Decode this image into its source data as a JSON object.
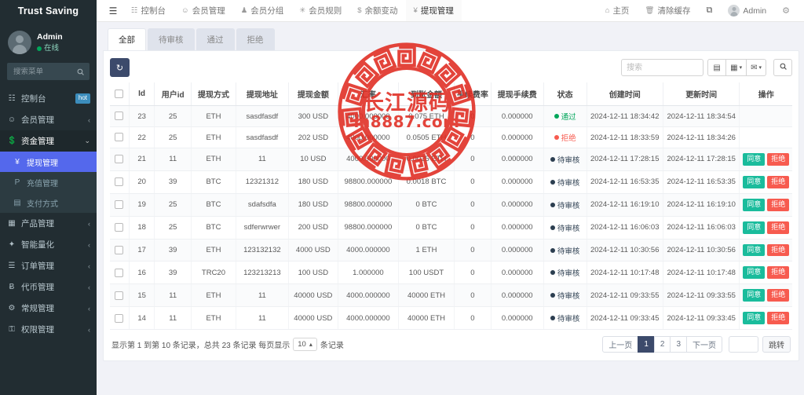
{
  "brand": {
    "title": "Trust Saving"
  },
  "user": {
    "name": "Admin",
    "status": "在线",
    "avatar_icon": "user-avatar-icon"
  },
  "sidebar": {
    "search_placeholder": "搜索菜单",
    "search_icon": "search-icon",
    "items": [
      {
        "label": "控制台",
        "icon": "dashboard-icon",
        "badge": "hot",
        "caret": ""
      },
      {
        "label": "会员管理",
        "icon": "user-icon",
        "badge": "",
        "caret": "‹"
      },
      {
        "label": "资金管理",
        "icon": "money-icon",
        "badge": "",
        "caret": "⌄"
      },
      {
        "label": "产品管理",
        "icon": "cubes-icon",
        "badge": "",
        "caret": "‹"
      },
      {
        "label": "智能量化",
        "icon": "diamond-icon",
        "badge": "",
        "caret": "‹"
      },
      {
        "label": "订单管理",
        "icon": "list-icon",
        "badge": "",
        "caret": "‹"
      },
      {
        "label": "代币管理",
        "icon": "bitcoin-icon",
        "badge": "",
        "caret": "‹"
      },
      {
        "label": "常规管理",
        "icon": "cogs-icon",
        "badge": "",
        "caret": "‹"
      },
      {
        "label": "权限管理",
        "icon": "shield-icon",
        "badge": "",
        "caret": "‹"
      }
    ],
    "submenu": [
      {
        "label": "提现管理",
        "icon": "yen-icon",
        "active": true
      },
      {
        "label": "充值管理",
        "icon": "paypal-icon",
        "active": false
      },
      {
        "label": "支付方式",
        "icon": "credit-card-icon",
        "active": false
      }
    ]
  },
  "navbar": {
    "burger_icon": "hamburger-icon",
    "left_items": [
      {
        "label": "控制台",
        "icon": "dashboard-icon",
        "selected": false
      },
      {
        "label": "会员管理",
        "icon": "user-icon",
        "selected": false
      },
      {
        "label": "会员分组",
        "icon": "group-icon",
        "selected": false
      },
      {
        "label": "会员规则",
        "icon": "wrench-icon",
        "selected": false
      },
      {
        "label": "余额变动",
        "icon": "dollar-icon",
        "selected": false
      },
      {
        "label": "提现管理",
        "icon": "yen-icon",
        "selected": true
      }
    ],
    "right_items": [
      {
        "label": "主页",
        "icon": "home-icon"
      },
      {
        "label": "清除缓存",
        "icon": "trash-icon"
      },
      {
        "label": "",
        "icon": "fullscreen-icon"
      },
      {
        "label": "Admin",
        "icon": "avatar-icon"
      },
      {
        "label": "",
        "icon": "gear-icon"
      }
    ]
  },
  "tabs": [
    {
      "label": "全部",
      "active": true
    },
    {
      "label": "待审核",
      "active": false
    },
    {
      "label": "通过",
      "active": false
    },
    {
      "label": "拒绝",
      "active": false
    }
  ],
  "toolbar": {
    "refresh_icon": "refresh-icon",
    "search_placeholder": "搜索",
    "search_value": "",
    "buttons": [
      {
        "icon": "columns-icon",
        "caret": ""
      },
      {
        "icon": "table-grid-icon",
        "caret": "▾"
      },
      {
        "icon": "export-icon",
        "caret": "▾"
      },
      {
        "icon": "search-icon",
        "caret": ""
      }
    ]
  },
  "table": {
    "select_all_icon": "checkbox-icon",
    "columns": [
      "Id",
      "用户id",
      "提现方式",
      "提现地址",
      "提现金额",
      "汇率",
      "到账金额",
      "手续费率",
      "提现手续费",
      "状态",
      "创建时间",
      "更新时间",
      "操作"
    ],
    "action_labels": {
      "approve": "同意",
      "reject": "拒绝"
    },
    "rows": [
      {
        "id": "23",
        "user_id": "25",
        "method": "ETH",
        "address": "sasdfasdf",
        "amount": "300 USD",
        "rate": "4000.000000",
        "received": "0.075 ETH",
        "fee_rate": "0",
        "fee": "0.000000",
        "status": "通过",
        "status_color": "#00a65a",
        "created": "2024-12-11 18:34:42",
        "updated": "2024-12-11 18:34:54",
        "has_actions": false
      },
      {
        "id": "22",
        "user_id": "25",
        "method": "ETH",
        "address": "sasdfasdf",
        "amount": "202 USD",
        "rate": "4000.000000",
        "received": "0.0505 ETH",
        "fee_rate": "0",
        "fee": "0.000000",
        "status": "拒绝",
        "status_color": "#f75b4f",
        "created": "2024-12-11 18:33:59",
        "updated": "2024-12-11 18:34:26",
        "has_actions": false
      },
      {
        "id": "21",
        "user_id": "11",
        "method": "ETH",
        "address": "11",
        "amount": "10 USD",
        "rate": "4000.000000",
        "received": "0.0025 ETH",
        "fee_rate": "0",
        "fee": "0.000000",
        "status": "待审核",
        "status_color": "#2c3e50",
        "created": "2024-12-11 17:28:15",
        "updated": "2024-12-11 17:28:15",
        "has_actions": true
      },
      {
        "id": "20",
        "user_id": "39",
        "method": "BTC",
        "address": "12321312",
        "amount": "180 USD",
        "rate": "98800.000000",
        "received": "0.0018 BTC",
        "fee_rate": "0",
        "fee": "0.000000",
        "status": "待审核",
        "status_color": "#2c3e50",
        "created": "2024-12-11 16:53:35",
        "updated": "2024-12-11 16:53:35",
        "has_actions": true
      },
      {
        "id": "19",
        "user_id": "25",
        "method": "BTC",
        "address": "sdafsdfa",
        "amount": "180 USD",
        "rate": "98800.000000",
        "received": "0 BTC",
        "fee_rate": "0",
        "fee": "0.000000",
        "status": "待审核",
        "status_color": "#2c3e50",
        "created": "2024-12-11 16:19:10",
        "updated": "2024-12-11 16:19:10",
        "has_actions": true
      },
      {
        "id": "18",
        "user_id": "25",
        "method": "BTC",
        "address": "sdferwrwer",
        "amount": "200 USD",
        "rate": "98800.000000",
        "received": "0 BTC",
        "fee_rate": "0",
        "fee": "0.000000",
        "status": "待审核",
        "status_color": "#2c3e50",
        "created": "2024-12-11 16:06:03",
        "updated": "2024-12-11 16:06:03",
        "has_actions": true
      },
      {
        "id": "17",
        "user_id": "39",
        "method": "ETH",
        "address": "123132132",
        "amount": "4000 USD",
        "rate": "4000.000000",
        "received": "1 ETH",
        "fee_rate": "0",
        "fee": "0.000000",
        "status": "待审核",
        "status_color": "#2c3e50",
        "created": "2024-12-11 10:30:56",
        "updated": "2024-12-11 10:30:56",
        "has_actions": true
      },
      {
        "id": "16",
        "user_id": "39",
        "method": "TRC20",
        "address": "123213213",
        "amount": "100 USD",
        "rate": "1.000000",
        "received": "100 USDT",
        "fee_rate": "0",
        "fee": "0.000000",
        "status": "待审核",
        "status_color": "#2c3e50",
        "created": "2024-12-11 10:17:48",
        "updated": "2024-12-11 10:17:48",
        "has_actions": true
      },
      {
        "id": "15",
        "user_id": "11",
        "method": "ETH",
        "address": "11",
        "amount": "40000 USD",
        "rate": "4000.000000",
        "received": "40000 ETH",
        "fee_rate": "0",
        "fee": "0.000000",
        "status": "待审核",
        "status_color": "#2c3e50",
        "created": "2024-12-11 09:33:55",
        "updated": "2024-12-11 09:33:55",
        "has_actions": true
      },
      {
        "id": "14",
        "user_id": "11",
        "method": "ETH",
        "address": "11",
        "amount": "40000 USD",
        "rate": "4000.000000",
        "received": "40000 ETH",
        "fee_rate": "0",
        "fee": "0.000000",
        "status": "待审核",
        "status_color": "#2c3e50",
        "created": "2024-12-11 09:33:45",
        "updated": "2024-12-11 09:33:45",
        "has_actions": true
      }
    ]
  },
  "footer": {
    "info_prefix": "显示第 1 到第 10 条记录，总共 23 条记录 每页显示",
    "page_size": "10",
    "page_size_caret": "▴",
    "info_suffix": "条记录",
    "prev_label": "上一页",
    "next_label": "下一页",
    "pages": [
      "1",
      "2",
      "3"
    ],
    "current_page": "1",
    "jump_value": "",
    "jump_label": "跳转"
  },
  "watermark": {
    "text": "长江源码",
    "sub": "m8887.com",
    "color": "#e02b21"
  }
}
